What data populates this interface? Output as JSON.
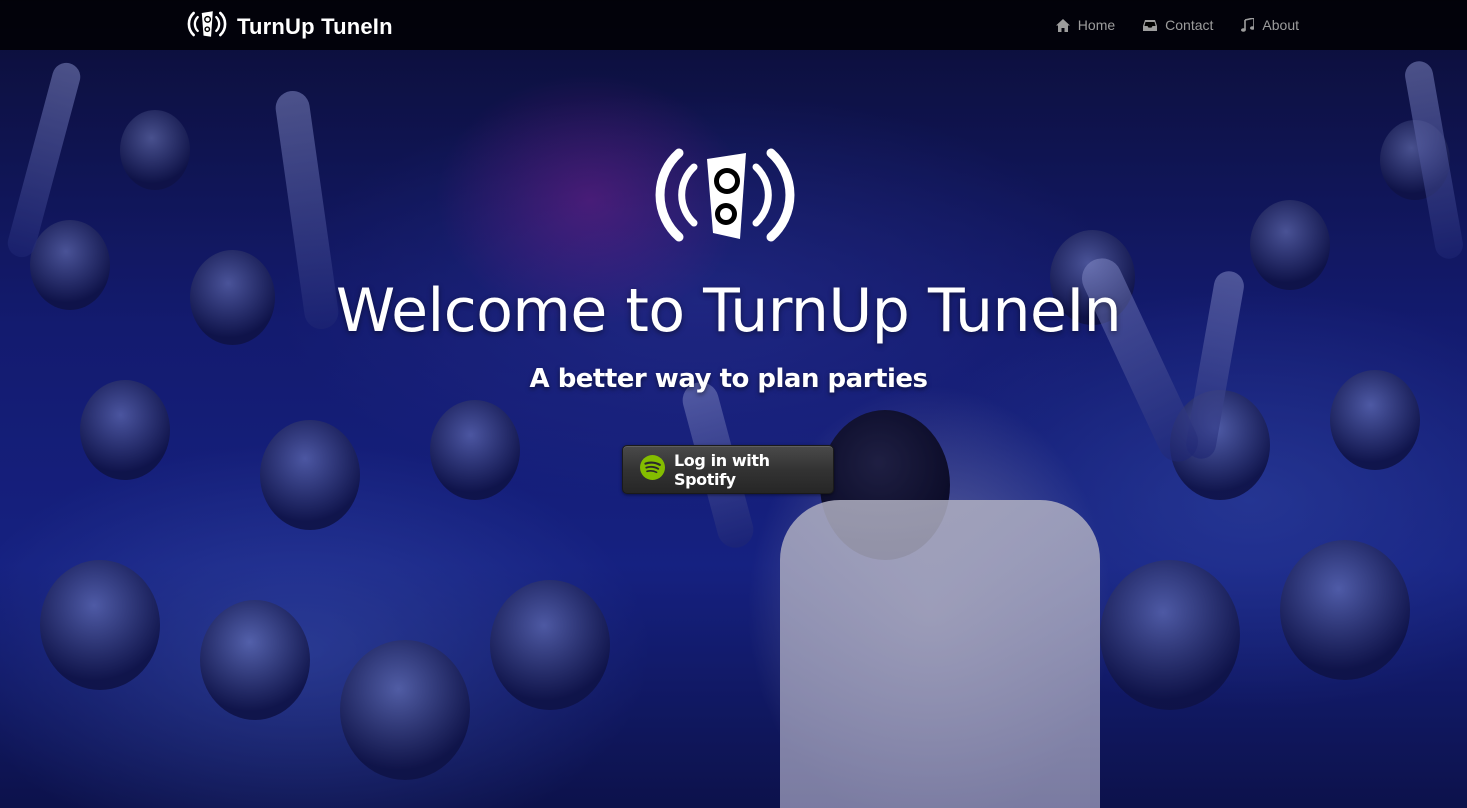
{
  "navbar": {
    "brand_name": "TurnUp TuneIn",
    "links": [
      {
        "label": "Home",
        "icon": "home-icon"
      },
      {
        "label": "Contact",
        "icon": "inbox-icon"
      },
      {
        "label": "About",
        "icon": "music-note-icon"
      }
    ]
  },
  "hero": {
    "title": "Welcome to TurnUp TuneIn",
    "subtitle": "A better way to plan parties",
    "login_button_label": "Log in with Spotify",
    "login_button_icon": "spotify-icon",
    "logo_icon": "speaker-broadcast-icon",
    "background": "concert-crowd-photo"
  },
  "colors": {
    "navbar_bg": "#000000",
    "nav_link": "#9d9d9d",
    "text": "#ffffff",
    "spotify_green": "#84bd00",
    "button_bg": "#333333"
  }
}
